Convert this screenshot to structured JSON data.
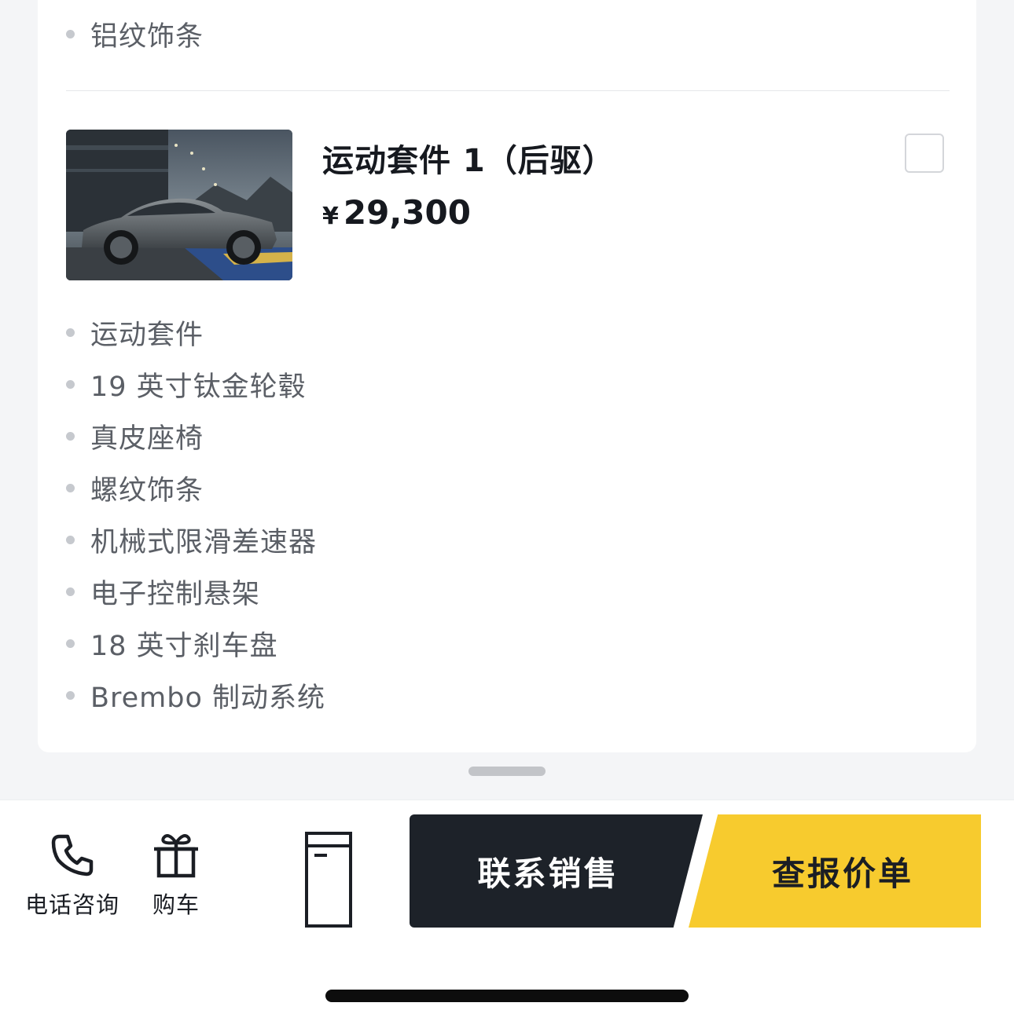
{
  "top_list": {
    "items": [
      "铝纹饰条"
    ]
  },
  "package": {
    "title": "运动套件 1（后驱）",
    "currency": "¥",
    "price": "29,300",
    "checked": false,
    "features": [
      "运动套件",
      "19 英寸钛金轮毂",
      "真皮座椅",
      "螺纹饰条",
      "机械式限滑差速器",
      "电子控制悬架",
      "18 英寸刹车盘",
      "Brembo 制动系统"
    ]
  },
  "bottom_bar": {
    "actions": [
      {
        "label": "电话咨询",
        "icon": "phone-icon"
      },
      {
        "label": "购车",
        "icon": "gift-icon"
      },
      {
        "label": "",
        "icon": "document-icon"
      }
    ],
    "primary_button": "联系销售",
    "secondary_button": "查报价单"
  },
  "colors": {
    "dark_button": "#1d2229",
    "accent_yellow": "#f7cb2e",
    "bullet": "#c6c9ce"
  }
}
